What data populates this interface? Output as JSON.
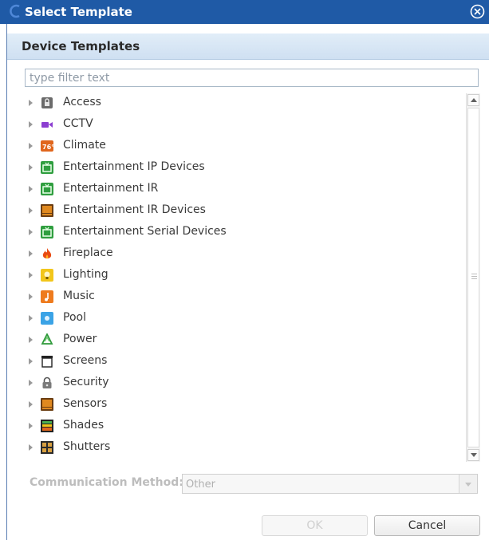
{
  "window": {
    "title": "Select Template"
  },
  "header": {
    "title": "Device Templates"
  },
  "filter": {
    "placeholder": "type filter text",
    "value": ""
  },
  "tree": {
    "items": [
      {
        "label": "Access",
        "icon": "lock-box-icon"
      },
      {
        "label": "CCTV",
        "icon": "camera-icon"
      },
      {
        "label": "Climate",
        "icon": "thermostat-icon"
      },
      {
        "label": "Entertainment IP Devices",
        "icon": "tv-icon"
      },
      {
        "label": "Entertainment IR",
        "icon": "tv-icon"
      },
      {
        "label": "Entertainment IR Devices",
        "icon": "monitor-icon"
      },
      {
        "label": "Entertainment Serial Devices",
        "icon": "tv-icon"
      },
      {
        "label": "Fireplace",
        "icon": "flame-icon"
      },
      {
        "label": "Lighting",
        "icon": "bulb-icon"
      },
      {
        "label": "Music",
        "icon": "music-note-icon"
      },
      {
        "label": "Pool",
        "icon": "pool-icon"
      },
      {
        "label": "Power",
        "icon": "recycle-icon"
      },
      {
        "label": "Screens",
        "icon": "screen-icon"
      },
      {
        "label": "Security",
        "icon": "padlock-icon"
      },
      {
        "label": "Sensors",
        "icon": "monitor-icon"
      },
      {
        "label": "Shades",
        "icon": "shades-icon"
      },
      {
        "label": "Shutters",
        "icon": "shutters-icon"
      }
    ]
  },
  "communication": {
    "label": "Communication Method:",
    "value": "Other"
  },
  "buttons": {
    "ok": "OK",
    "cancel": "Cancel"
  },
  "colors": {
    "titlebar": "#1f5aa6",
    "header": "#d8e7f6"
  }
}
